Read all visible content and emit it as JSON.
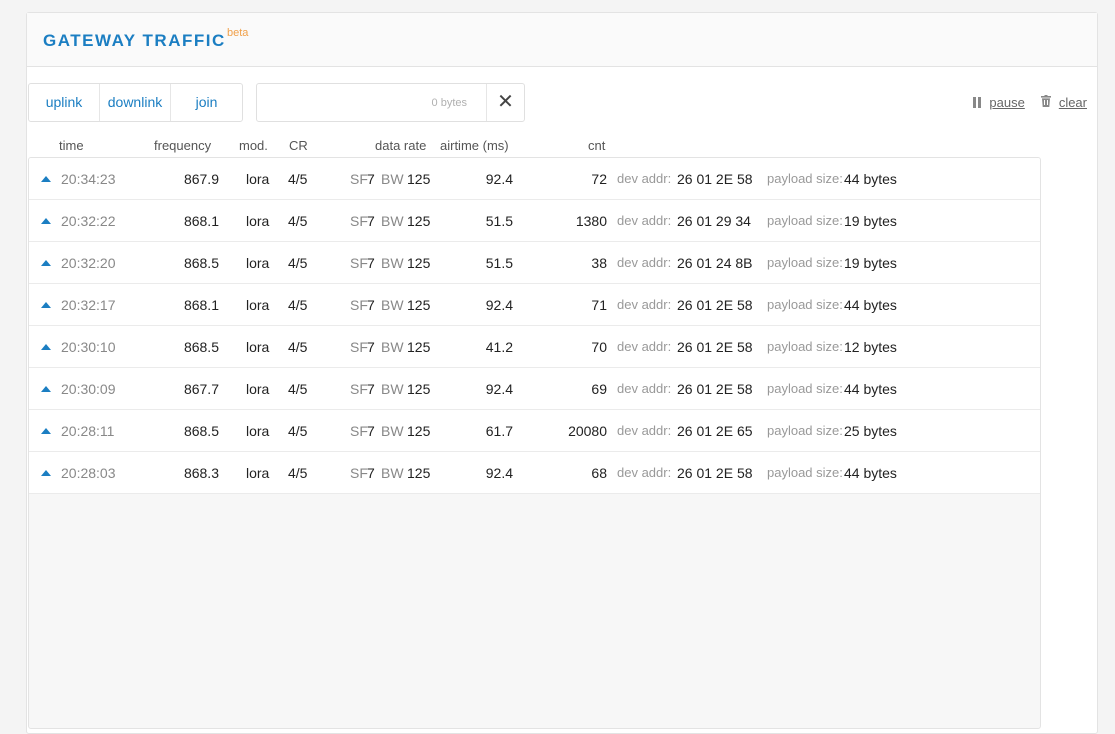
{
  "header": {
    "title": "GATEWAY TRAFFIC",
    "badge": "beta"
  },
  "filters": [
    {
      "label": "uplink"
    },
    {
      "label": "downlink"
    },
    {
      "label": "join"
    }
  ],
  "search": {
    "placeholder": "0 bytes",
    "clear_label": "✕"
  },
  "actions": {
    "pause_label": "pause",
    "clear_label": "clear"
  },
  "columns": {
    "time": "time",
    "frequency": "frequency",
    "mod": "mod.",
    "cr": "CR",
    "data_rate": "data rate",
    "airtime": "airtime (ms)",
    "cnt": "cnt"
  },
  "labels": {
    "sf": "SF",
    "bw": "BW",
    "dev_addr": "dev addr:",
    "payload_size": "payload size:"
  },
  "rows": [
    {
      "time": "20:34:23",
      "frequency": "867.9",
      "mod": "lora",
      "cr": "4/5",
      "sf": "7",
      "bw": "125",
      "airtime": "92.4",
      "cnt": "72",
      "dev_addr": "26 01 2E 58",
      "payload": "44 bytes"
    },
    {
      "time": "20:32:22",
      "frequency": "868.1",
      "mod": "lora",
      "cr": "4/5",
      "sf": "7",
      "bw": "125",
      "airtime": "51.5",
      "cnt": "1380",
      "dev_addr": "26 01 29 34",
      "payload": "19 bytes"
    },
    {
      "time": "20:32:20",
      "frequency": "868.5",
      "mod": "lora",
      "cr": "4/5",
      "sf": "7",
      "bw": "125",
      "airtime": "51.5",
      "cnt": "38",
      "dev_addr": "26 01 24 8B",
      "payload": "19 bytes"
    },
    {
      "time": "20:32:17",
      "frequency": "868.1",
      "mod": "lora",
      "cr": "4/5",
      "sf": "7",
      "bw": "125",
      "airtime": "92.4",
      "cnt": "71",
      "dev_addr": "26 01 2E 58",
      "payload": "44 bytes"
    },
    {
      "time": "20:30:10",
      "frequency": "868.5",
      "mod": "lora",
      "cr": "4/5",
      "sf": "7",
      "bw": "125",
      "airtime": "41.2",
      "cnt": "70",
      "dev_addr": "26 01 2E 58",
      "payload": "12 bytes"
    },
    {
      "time": "20:30:09",
      "frequency": "867.7",
      "mod": "lora",
      "cr": "4/5",
      "sf": "7",
      "bw": "125",
      "airtime": "92.4",
      "cnt": "69",
      "dev_addr": "26 01 2E 58",
      "payload": "44 bytes"
    },
    {
      "time": "20:28:11",
      "frequency": "868.5",
      "mod": "lora",
      "cr": "4/5",
      "sf": "7",
      "bw": "125",
      "airtime": "61.7",
      "cnt": "20080",
      "dev_addr": "26 01 2E 65",
      "payload": "25 bytes"
    },
    {
      "time": "20:28:03",
      "frequency": "868.3",
      "mod": "lora",
      "cr": "4/5",
      "sf": "7",
      "bw": "125",
      "airtime": "92.4",
      "cnt": "68",
      "dev_addr": "26 01 2E 58",
      "payload": "44 bytes"
    }
  ]
}
